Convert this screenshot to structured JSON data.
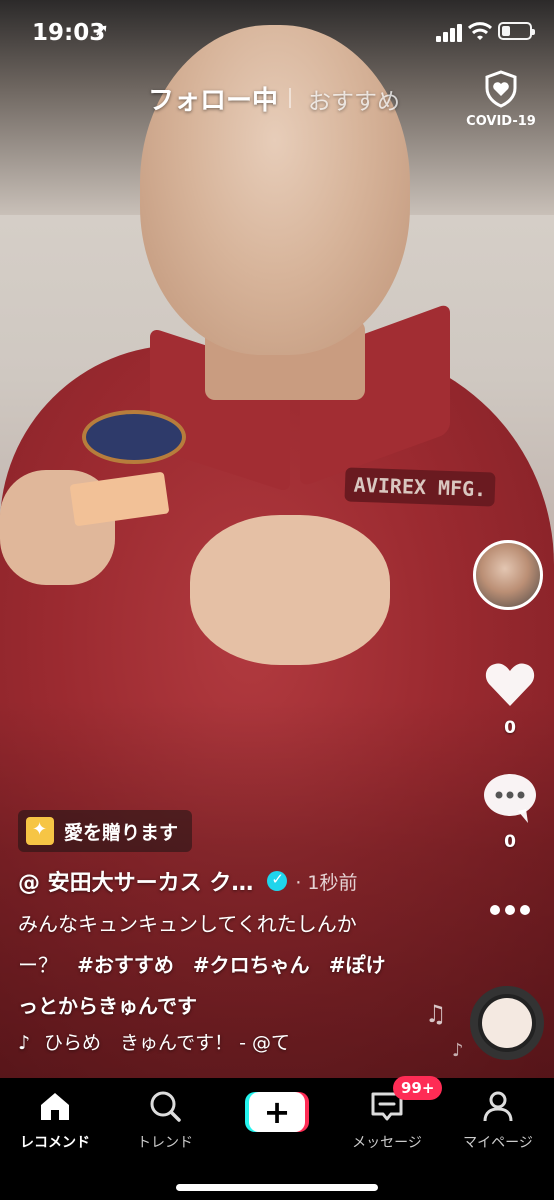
{
  "status_bar": {
    "time": "19:03",
    "battery_level": 0.3
  },
  "top_tabs": {
    "following": "フォロー中",
    "recommended": "おすすめ",
    "covid_label": "COVID-19"
  },
  "video": {
    "name_tag_text": "AVIREX MFG."
  },
  "actions": {
    "like_count": "0",
    "comment_count": "0"
  },
  "post": {
    "gift_label": "愛を贈ります",
    "author": "@ 安田大サーカス ク…",
    "time_ago": "· 1秒前",
    "caption_line1": "みんなキュンキュンしてくれたしんか",
    "caption_line2_text": "ー？",
    "hashtags": [
      "#おすすめ",
      "#クロちゃん",
      "#ぽけ"
    ],
    "caption_line3": "っとからきゅんです",
    "sound": "ひらめ　きゅんです！ - @て"
  },
  "nav": {
    "home": "レコメンド",
    "trend": "トレンド",
    "create_symbol": "+",
    "messages": "メッセージ",
    "messages_badge": "99+",
    "profile": "マイページ"
  },
  "colors": {
    "accent_red": "#fe2c55",
    "accent_cyan": "#25f4ee",
    "verified": "#20d5ec"
  }
}
